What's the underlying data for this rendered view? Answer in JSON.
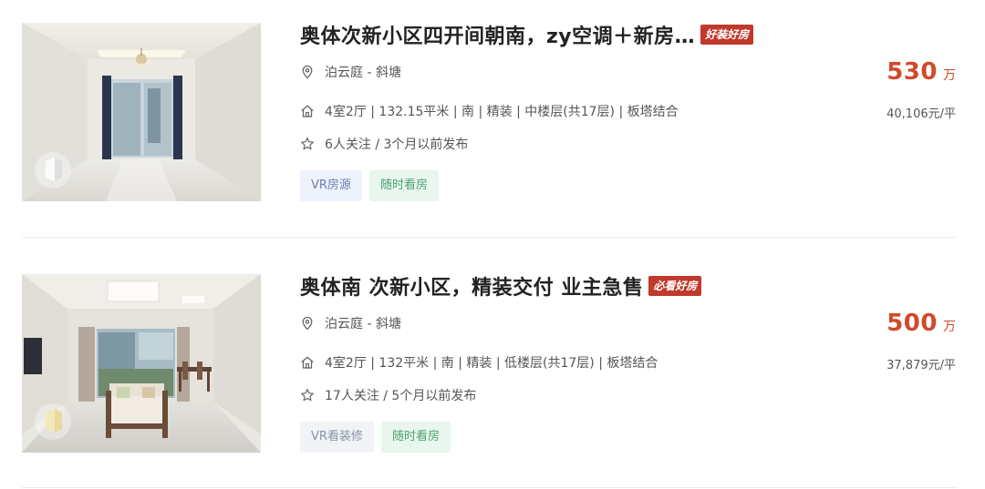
{
  "listings": [
    {
      "title": "奥体次新小区四开间朝南，zy空调＋新房…",
      "badge": "好装好房",
      "location": "泊云庭 - 斜塘",
      "house_info": "4室2厅 | 132.15平米 | 南 | 精装 | 中楼层(共17层) | 板塔结合",
      "follow_info": "6人关注 / 3个月以前发布",
      "tags": [
        "VR房源",
        "随时看房"
      ],
      "total_price": "530",
      "price_unit": "万",
      "unit_price": "40,106元/平"
    },
    {
      "title": "奥体南 次新小区，精装交付 业主急售",
      "badge": "必看好房",
      "location": "泊云庭 - 斜塘",
      "house_info": "4室2厅 | 132平米 | 南 | 精装 | 低楼层(共17层) | 板塔结合",
      "follow_info": "17人关注 / 5个月以前发布",
      "tags": [
        "VR看装修",
        "随时看房"
      ],
      "total_price": "500",
      "price_unit": "万",
      "unit_price": "37,879元/平"
    }
  ],
  "icons": {
    "location": "location-pin-icon",
    "house": "house-icon",
    "follow": "star-icon",
    "vr": "vr-cube-icon"
  },
  "colors": {
    "price": "#d14a2b",
    "badge": "#c0392b",
    "tag_vr_text": "#6b7fb4",
    "tag_anytime_text": "#4ea26f"
  }
}
